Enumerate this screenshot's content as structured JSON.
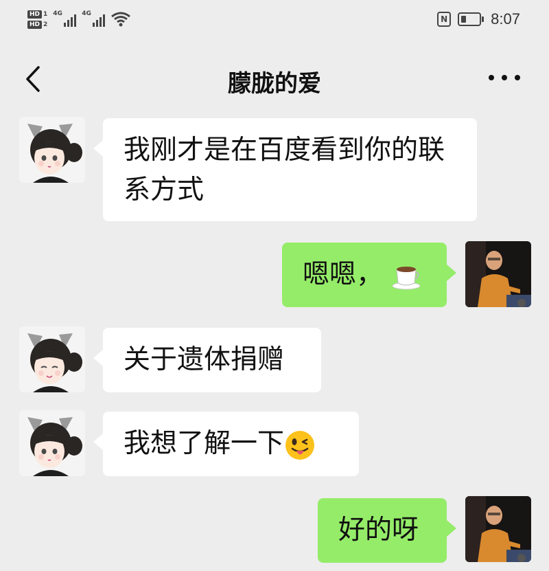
{
  "status_bar": {
    "hd1": "HD",
    "hd1_num": "1",
    "hd2": "HD",
    "hd2_num": "2",
    "net1": "4G",
    "net2": "4G",
    "nfc": "N",
    "time": "8:07"
  },
  "nav": {
    "title": "朦胧的爱",
    "back_icon": "chevron-left-icon",
    "more_icon": "more-dots-icon"
  },
  "messages": [
    {
      "side": "left",
      "text": "我刚才是在百度看到你的联系方式"
    },
    {
      "side": "right",
      "text": "嗯嗯，",
      "emoji": "coffee-cup-icon"
    },
    {
      "side": "left",
      "text": "关于遗体捐赠"
    },
    {
      "side": "left",
      "text": "我想了解一下",
      "emoji": "winking-tongue-face-icon"
    },
    {
      "side": "right",
      "text": "好的呀"
    }
  ],
  "colors": {
    "background": "#ededed",
    "bubble_left": "#ffffff",
    "bubble_right": "#95ec69"
  }
}
